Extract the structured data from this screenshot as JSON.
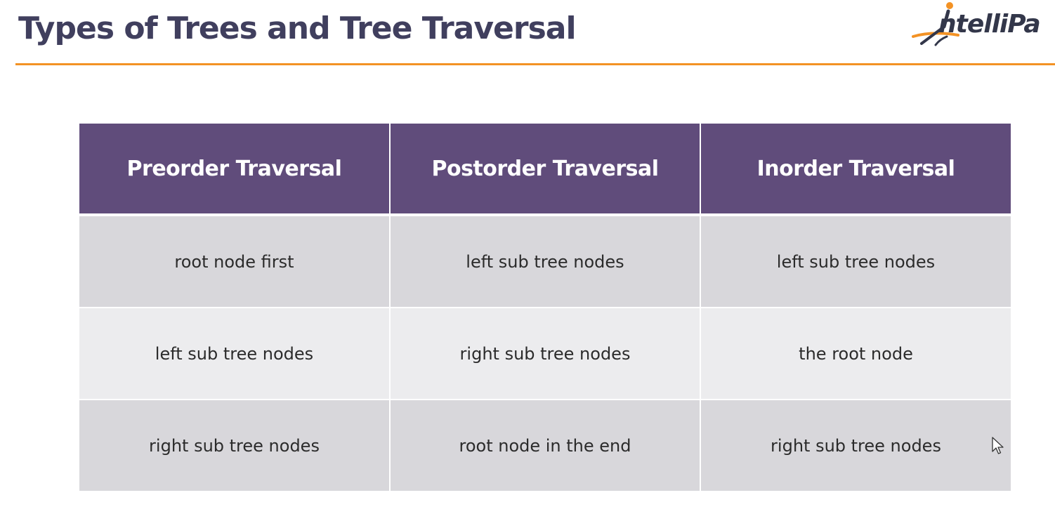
{
  "slide": {
    "title": "Types of Trees and Tree Traversal"
  },
  "logo": {
    "text": "ntelliPa",
    "icon": "intellipaat-figure-swoosh-logo",
    "color": "#33374a",
    "accent_color": "#f39224"
  },
  "colors": {
    "title": "#403f5e",
    "rule": "#f39224",
    "header_bg": "#604c7b",
    "row_dark": "#d8d7db",
    "row_light": "#ececee"
  },
  "table": {
    "headers": [
      "Preorder Traversal",
      "Postorder Traversal",
      "Inorder Traversal"
    ],
    "rows": [
      [
        "root node first",
        "left sub tree nodes",
        "left sub tree nodes"
      ],
      [
        "left sub tree nodes",
        "right sub tree nodes",
        "the root node"
      ],
      [
        "right sub tree nodes",
        "root node in the end",
        "right sub tree nodes"
      ]
    ]
  },
  "cursor": {
    "icon": "mouse-pointer-icon"
  }
}
